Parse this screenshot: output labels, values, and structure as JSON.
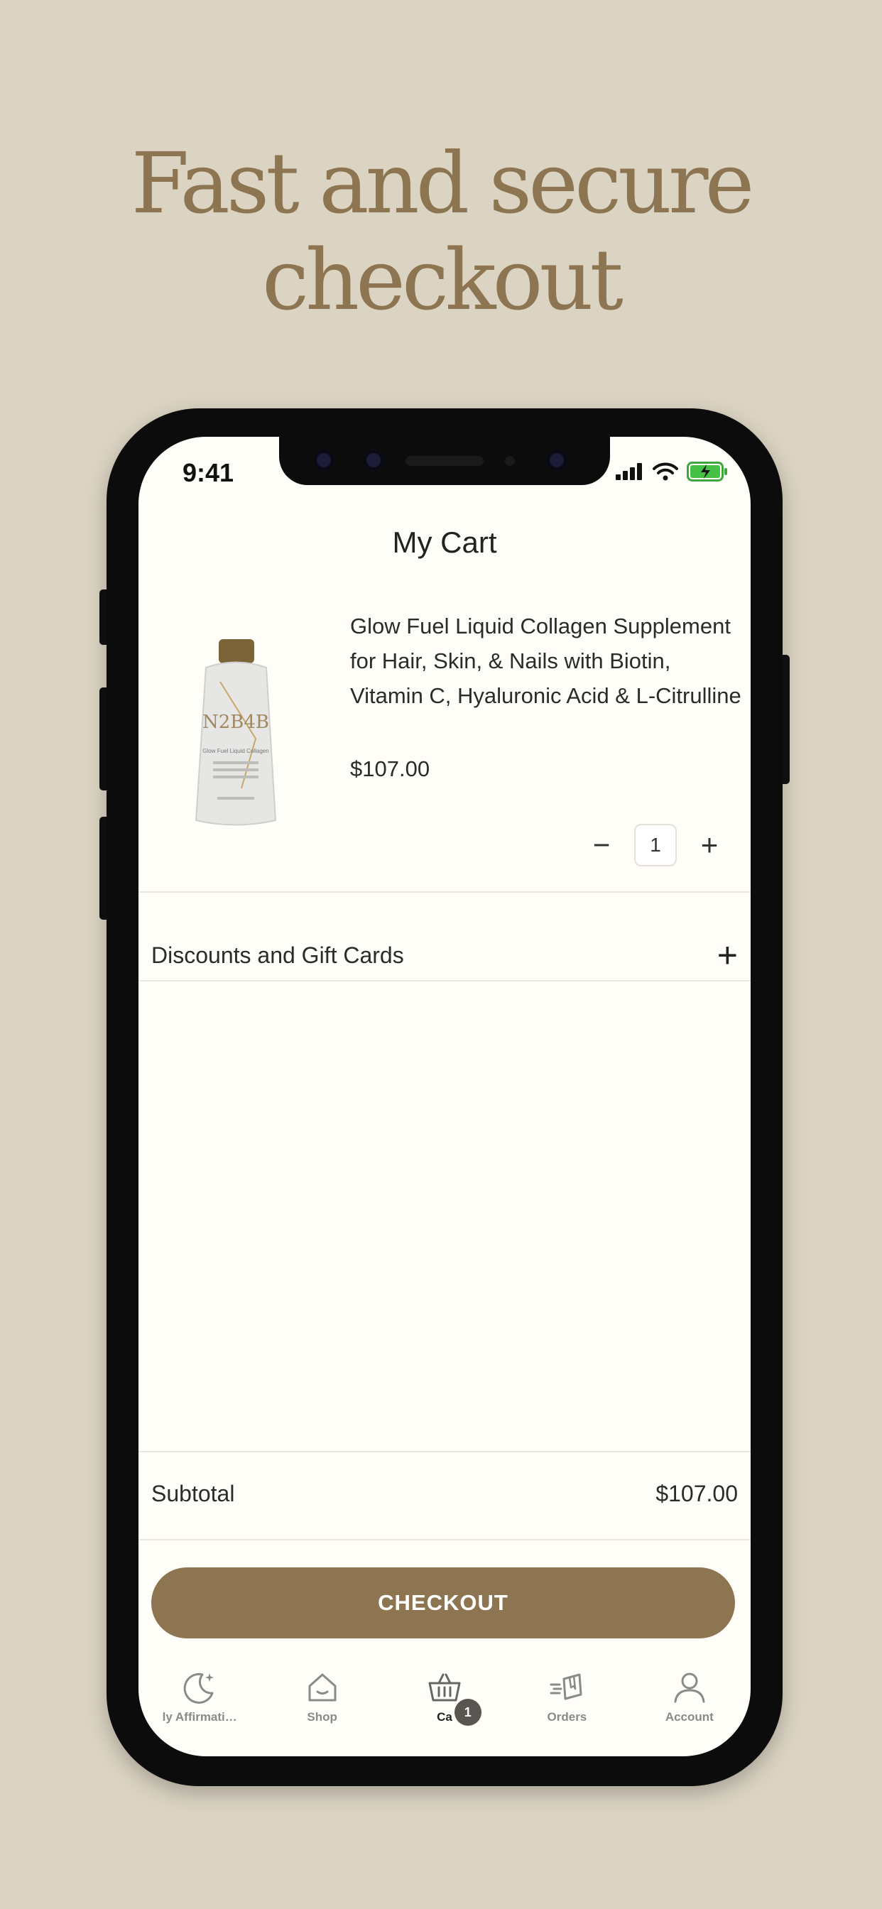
{
  "promo": {
    "headline_line1": "Fast and secure",
    "headline_line2": "checkout"
  },
  "status_bar": {
    "time": "9:41",
    "icons": [
      "signal-icon",
      "wifi-icon",
      "battery-charging-icon"
    ]
  },
  "cart": {
    "title": "My Cart",
    "item": {
      "name": "Glow Fuel Liquid Collagen Supplement for Hair, Skin, & Nails with Biotin, Vitamin C, Hyaluronic Acid & L-Citrulline",
      "price": "$107.00",
      "quantity": "1",
      "decrement_symbol": "−",
      "increment_symbol": "+",
      "pouch_brand": "N2B4B",
      "pouch_label": "Glow Fuel Liquid Collagen"
    },
    "discounts_label": "Discounts and Gift Cards",
    "discounts_expand_symbol": "+",
    "subtotal_label": "Subtotal",
    "subtotal_value": "$107.00",
    "checkout_label": "CHECKOUT"
  },
  "tabbar": {
    "tabs": [
      {
        "label": "ly Affirmati…",
        "icon": "moon-stars-icon"
      },
      {
        "label": "Shop",
        "icon": "home-icon"
      },
      {
        "label": "Ca",
        "icon": "basket-icon",
        "badge": "1",
        "active": true
      },
      {
        "label": "Orders",
        "icon": "delivery-box-icon"
      },
      {
        "label": "Account",
        "icon": "person-icon"
      }
    ]
  },
  "colors": {
    "background": "#dcd4c3",
    "accent": "#8c7550",
    "screen": "#fefdf7"
  }
}
